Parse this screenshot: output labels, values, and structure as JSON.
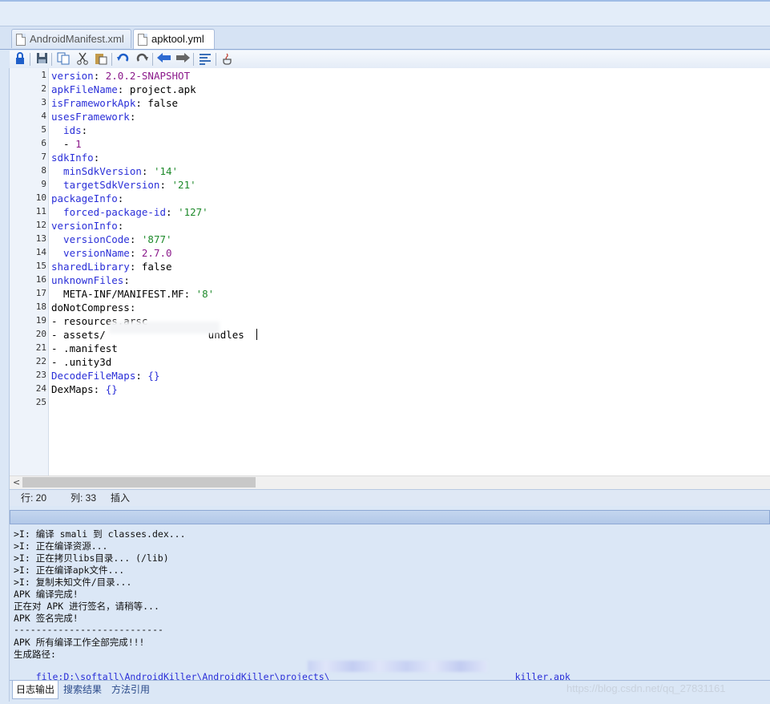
{
  "tabs": [
    {
      "label": "AndroidManifest.xml",
      "active": false
    },
    {
      "label": "apktool.yml",
      "active": true
    }
  ],
  "toolbar": {
    "icons": [
      "lock-icon",
      "save-icon",
      "copy-icon",
      "cut-icon",
      "paste-icon",
      "undo-icon",
      "redo-icon",
      "back-arrow-icon",
      "forward-arrow-icon",
      "format-icon",
      "java-icon"
    ]
  },
  "editor": {
    "line_numbers": [
      "1",
      "2",
      "3",
      "4",
      "5",
      "6",
      "7",
      "8",
      "9",
      "10",
      "11",
      "12",
      "13",
      "14",
      "15",
      "16",
      "17",
      "18",
      "19",
      "20",
      "21",
      "22",
      "23",
      "24",
      "25"
    ],
    "lines": [
      {
        "key": "version",
        "sep": ": ",
        "val": "2.0.2-SNAPSHOT",
        "vc": "n"
      },
      {
        "key": "apkFileName",
        "sep": ": ",
        "val": "project.apk",
        "vc": "v"
      },
      {
        "key": "isFrameworkApk",
        "sep": ": ",
        "val": "false",
        "vc": "v"
      },
      {
        "key": "usesFramework",
        "sep": ":",
        "val": "",
        "vc": "v"
      },
      {
        "key": "  ids",
        "sep": ":",
        "val": "",
        "vc": "v"
      },
      {
        "key": "",
        "sep": "  - ",
        "val": "1",
        "vc": "n"
      },
      {
        "key": "sdkInfo",
        "sep": ":",
        "val": "",
        "vc": "v"
      },
      {
        "key": "  minSdkVersion",
        "sep": ": ",
        "val": "'14'",
        "vc": "s"
      },
      {
        "key": "  targetSdkVersion",
        "sep": ": ",
        "val": "'21'",
        "vc": "s"
      },
      {
        "key": "packageInfo",
        "sep": ":",
        "val": "",
        "vc": "v"
      },
      {
        "key": "  forced-package-id",
        "sep": ": ",
        "val": "'127'",
        "vc": "s"
      },
      {
        "key": "versionInfo",
        "sep": ":",
        "val": "",
        "vc": "v"
      },
      {
        "key": "  versionCode",
        "sep": ": ",
        "val": "'877'",
        "vc": "s"
      },
      {
        "key": "  versionName",
        "sep": ": ",
        "val": "2.7.0",
        "vc": "n"
      },
      {
        "key": "sharedLibrary",
        "sep": ": ",
        "val": "false",
        "vc": "v"
      },
      {
        "key": "unknownFiles",
        "sep": ":",
        "val": "",
        "vc": "v"
      },
      {
        "key": "",
        "sep": "  META-INF/MANIFEST.MF: ",
        "val": "'8'",
        "vc": "s"
      },
      {
        "key": "",
        "sep": "doNotCompress:",
        "val": "",
        "vc": "v"
      },
      {
        "key": "",
        "sep": "- resources.arsc",
        "val": "",
        "vc": "v"
      },
      {
        "key": "",
        "sep": "- assets/                 undles",
        "val": "",
        "vc": "v"
      },
      {
        "key": "",
        "sep": "- .manifest",
        "val": "",
        "vc": "v"
      },
      {
        "key": "",
        "sep": "- .unity3d",
        "val": "",
        "vc": "v"
      },
      {
        "key": "DecodeFileMaps",
        "sep": ": ",
        "val": "{}",
        "vc": "br"
      },
      {
        "key": "",
        "sep": "DexMaps: ",
        "val": "{}",
        "vc": "br"
      },
      {
        "key": "",
        "sep": "",
        "val": "",
        "vc": "v"
      }
    ]
  },
  "status": {
    "row_label": "行: 20",
    "col_label": "列: 33",
    "mode": "插入"
  },
  "log": {
    "lines": [
      ">I: 编译 smali 到 classes.dex...",
      ">I: 正在编译资源...",
      ">I: 正在拷贝libs目录... (/lib)",
      ">I: 正在编译apk文件...",
      ">I: 复制未知文件/目录...",
      "APK 编译完成!",
      "正在对 APK 进行签名，请稍等...",
      "APK 签名完成!",
      "---------------------------",
      "APK 所有编译工作全部完成!!!",
      "生成路径:"
    ],
    "path_prefix": "file:D:\\softall\\AndroidKiller\\AndroidKiller\\projects\\",
    "path_suffix": "_killer.apk"
  },
  "bottom_tabs": [
    "日志输出",
    "搜索结果",
    "方法引用"
  ],
  "watermark": "https://blog.csdn.net/qq_27831161",
  "colors": {
    "key": "#2a2fd8",
    "string": "#1e8a2b",
    "number": "#8b1a8b"
  }
}
